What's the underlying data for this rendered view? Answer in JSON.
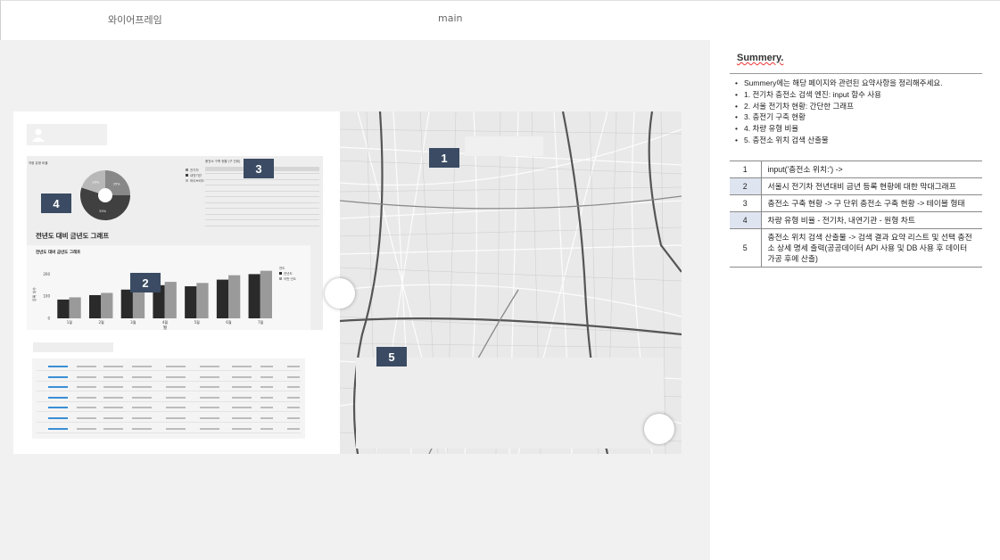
{
  "tabs": {
    "wireframe": "와이어프레임",
    "main": "main"
  },
  "colors": {
    "badge": "#3a4b63",
    "canvas": "#f1f1f1",
    "accent_line": "#3a8fd6"
  },
  "badges": {
    "b1": "1",
    "b2": "2",
    "b3": "3",
    "b4": "4",
    "b5": "5"
  },
  "panel": {
    "chart_heading": "전년도 대비 금년도 그래프",
    "chart_subheading": "전년도 대비 금년도 그래프",
    "pie_title": "차량 유형 비율",
    "pie_legend": [
      "전기차",
      "내연기관",
      "하이브리드"
    ],
    "table_title": "충전소 구축 현황 (구 단위)",
    "bar_legend_title": "연도",
    "bar_legend": [
      "전년도",
      "이번 년도"
    ],
    "xlabel": "월",
    "ylabel": "등록 대수"
  },
  "chart_data": [
    {
      "type": "bar",
      "categories": [
        "1월",
        "2월",
        "3월",
        "4월",
        "5월",
        "6월",
        "7월"
      ],
      "series": [
        {
          "name": "전년도",
          "values": [
            85,
            105,
            130,
            150,
            145,
            175,
            200
          ]
        },
        {
          "name": "이번 년도",
          "values": [
            95,
            115,
            140,
            165,
            160,
            195,
            215
          ]
        }
      ],
      "ylim": [
        0,
        250
      ],
      "yticks": [
        0,
        100,
        200
      ],
      "title": "전년도 대비 금년도 그래프",
      "xlabel": "월",
      "ylabel": "등록 대수"
    },
    {
      "type": "pie",
      "labels": [
        "전기차",
        "내연기관",
        "하이브리드"
      ],
      "values": [
        25,
        55,
        20
      ],
      "slice_labels": [
        "25%",
        "55%",
        "20%"
      ],
      "colors": [
        "#888888",
        "#404040",
        "#b8b8b8"
      ],
      "title": "차량 유형 비율"
    }
  ],
  "summary": {
    "title": "Summery.",
    "bullets": [
      "Summery에는 해당 페이지와 관련된 요약사항을 정리해주세요.",
      "1. 전기차 충전소 검색 엔진: input 함수 사용",
      "2. 서울 전기차 현황: 간단한 그래프",
      "3. 충전기 구축 현황",
      "4. 차량 유형 비율",
      "5. 충전소 위치 검색 산출물"
    ],
    "rows": [
      {
        "num": "1",
        "text": "input('충전소 위치:') ->"
      },
      {
        "num": "2",
        "text": "서울시 전기차 전년대비 금년 등록 현황에 대한 막대그래프"
      },
      {
        "num": "3",
        "text": "충전소 구축 현황 -> 구 단위 충전소 구축 현황 -> 테이블 형태"
      },
      {
        "num": "4",
        "text": "차량 유형 비율 - 전기차, 내연기관 - 원형 차트"
      },
      {
        "num": "5",
        "text": "충전소 위치 검색 산출물 -> 검색 결과 요약 리스트 및 선택 충전소 상세 명세 출력(공공데이터 API 사용 및 DB 사용 후 데이터 가공 후에 산출)"
      }
    ]
  }
}
